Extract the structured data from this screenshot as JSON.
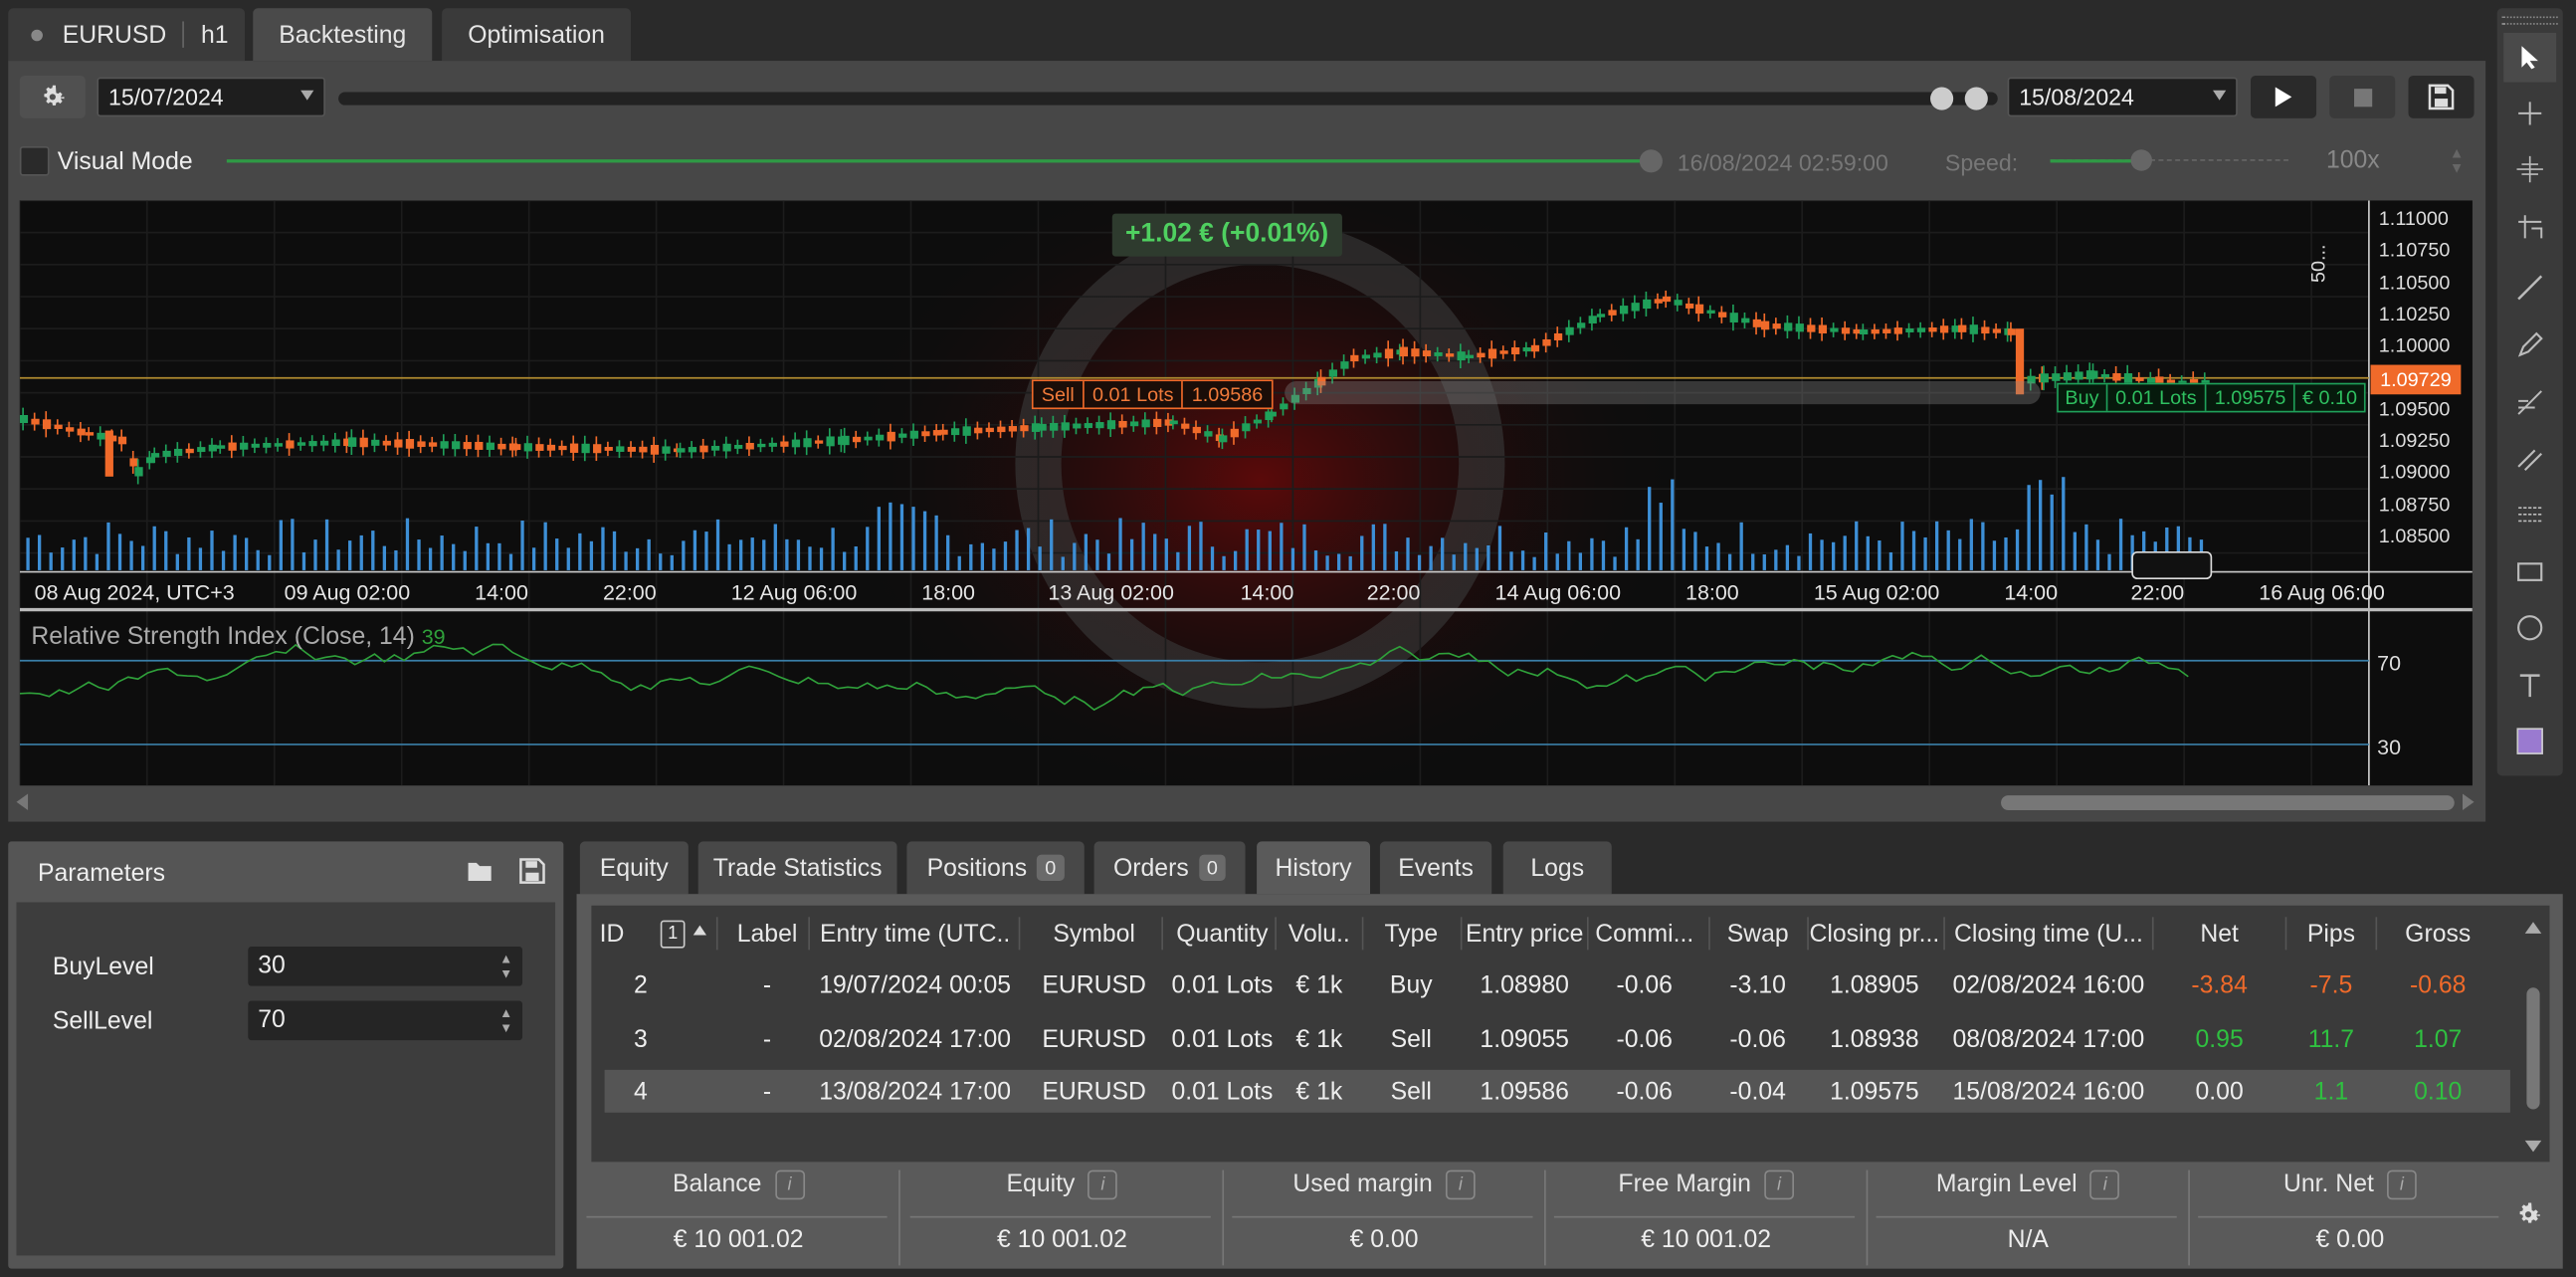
{
  "top_tabs": {
    "symbol": "EURUSD",
    "timeframe": "h1",
    "backtesting": "Backtesting",
    "optimisation": "Optimisation"
  },
  "toolbar": {
    "start_date": "15/07/2024",
    "end_date": "15/08/2024",
    "visual_mode": "Visual Mode",
    "current_time": "16/08/2024 02:59:00",
    "speed_label": "Speed:",
    "speed_value": "100x"
  },
  "chart": {
    "profit_label": "+1.02 € (+0.01%)",
    "price_ticks": [
      "1.11000",
      "1.10750",
      "1.10500",
      "1.10250",
      "1.10000",
      "1.09500",
      "1.09250",
      "1.09000",
      "1.08750",
      "1.08500"
    ],
    "current_price": "1.09729",
    "scale_label": "50...",
    "x_ticks": [
      "08 Aug 2024, UTC+3",
      "09 Aug 02:00",
      "14:00",
      "22:00",
      "12 Aug 06:00",
      "18:00",
      "13 Aug 02:00",
      "14:00",
      "22:00",
      "14 Aug 06:00",
      "18:00",
      "15 Aug 02:00",
      "14:00",
      "22:00",
      "16 Aug 06:00"
    ],
    "sell_tag": {
      "side": "Sell",
      "lots": "0.01 Lots",
      "price": "1.09586"
    },
    "buy_tag": {
      "side": "Buy",
      "lots": "0.01 Lots",
      "price": "1.09575",
      "pnl": "€ 0.10"
    },
    "rsi_title": "Relative Strength Index (Close, 14)",
    "rsi_value": "39",
    "rsi_levels": [
      "70",
      "30"
    ],
    "colors": {
      "bull": "#1fa05a",
      "bear": "#f06a2a",
      "rsi": "#2fa03a",
      "volume": "#3d8fd6"
    }
  },
  "parameters": {
    "title": "Parameters",
    "items": [
      {
        "label": "BuyLevel",
        "value": "30"
      },
      {
        "label": "SellLevel",
        "value": "70"
      }
    ]
  },
  "bottom_tabs": {
    "equity": "Equity",
    "trade_stats": "Trade Statistics",
    "positions": "Positions",
    "positions_count": "0",
    "orders": "Orders",
    "orders_count": "0",
    "history": "History",
    "events": "Events",
    "logs": "Logs"
  },
  "history": {
    "sort_badge": "1",
    "headers": [
      "ID",
      "Label",
      "Entry time (UTC..",
      "Symbol",
      "Quantity",
      "Volu..",
      "Type",
      "Entry price",
      "Commi...",
      "Swap",
      "Closing pr...",
      "Closing time (U...",
      "Net",
      "Pips",
      "Gross"
    ],
    "rows": [
      [
        "2",
        "-",
        "19/07/2024 00:05",
        "EURUSD",
        "0.01 Lots",
        "€ 1k",
        "Buy",
        "1.08980",
        "-0.06",
        "-3.10",
        "1.08905",
        "02/08/2024 16:00",
        "-3.84",
        "-7.5",
        "-0.68"
      ],
      [
        "3",
        "-",
        "02/08/2024 17:00",
        "EURUSD",
        "0.01 Lots",
        "€ 1k",
        "Sell",
        "1.09055",
        "-0.06",
        "-0.06",
        "1.08938",
        "08/08/2024 17:00",
        "0.95",
        "11.7",
        "1.07"
      ],
      [
        "4",
        "-",
        "13/08/2024 17:00",
        "EURUSD",
        "0.01 Lots",
        "€ 1k",
        "Sell",
        "1.09586",
        "-0.06",
        "-0.04",
        "1.09575",
        "15/08/2024 16:00",
        "0.00",
        "1.1",
        "0.10"
      ]
    ]
  },
  "account": [
    {
      "label": "Balance",
      "value": "€ 10 001.02"
    },
    {
      "label": "Equity",
      "value": "€ 10 001.02"
    },
    {
      "label": "Used margin",
      "value": "€ 0.00"
    },
    {
      "label": "Free Margin",
      "value": "€ 10 001.02"
    },
    {
      "label": "Margin Level",
      "value": "N/A"
    },
    {
      "label": "Unr. Net",
      "value": "€ 0.00"
    }
  ],
  "info_glyph": "i"
}
